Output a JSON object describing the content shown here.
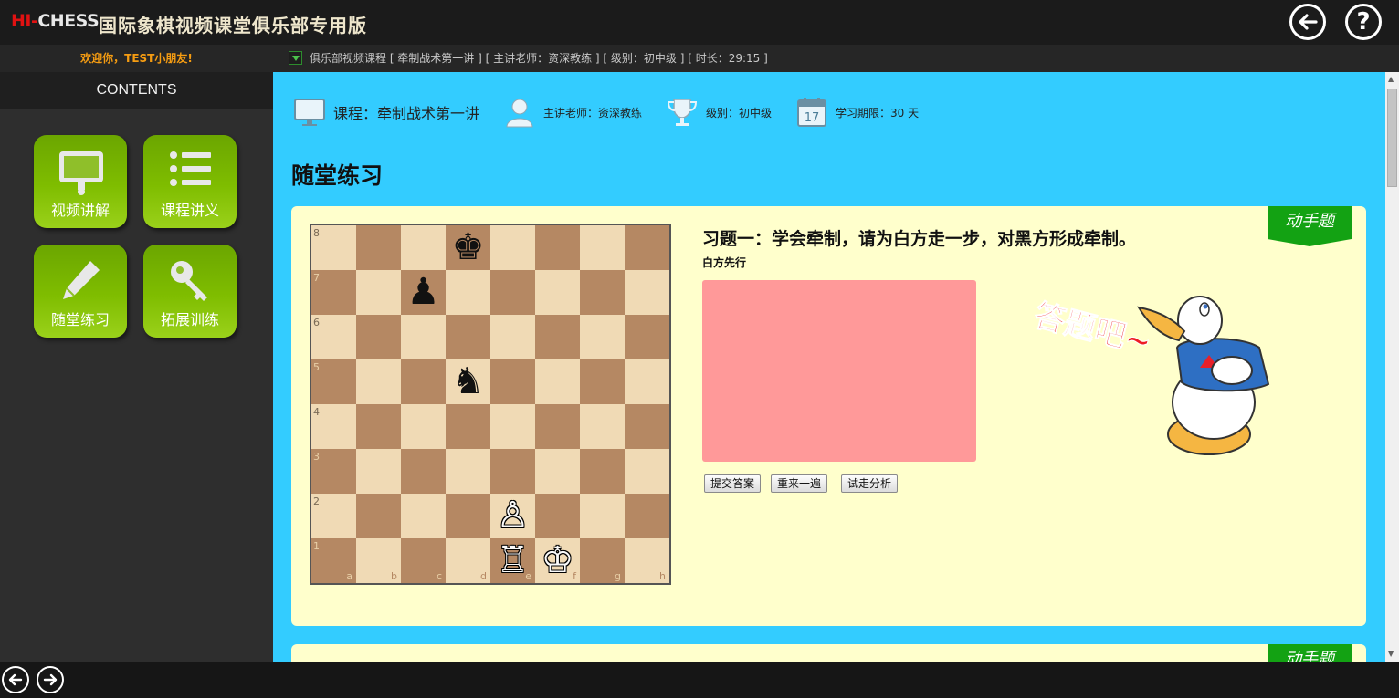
{
  "header": {
    "logo_hi": "HI-",
    "logo_chess": "CHESS",
    "app_title": "国际象棋视频课堂俱乐部专用版",
    "help_label": "?"
  },
  "sidebar": {
    "welcome": "欢迎你，TEST小朋友!",
    "contents_title": "CONTENTS",
    "tiles": [
      {
        "label": "视频讲解",
        "icon": "monitor-icon"
      },
      {
        "label": "课程讲义",
        "icon": "list-icon"
      },
      {
        "label": "随堂练习",
        "icon": "pencil-icon"
      },
      {
        "label": "拓展训练",
        "icon": "key-icon"
      }
    ]
  },
  "infobar": {
    "text": "俱乐部视频课程 [ 牵制战术第一讲 ] [ 主讲老师：资深教练 ] [ 级别：初中级 ] [ 时长：29:15 ]"
  },
  "meta": {
    "course": "课程：牵制战术第一讲",
    "teacher": "主讲老师：资深教练",
    "level": "级别：初中级",
    "period": "学习期限：30 天",
    "calendar_day": "17"
  },
  "section_title": "随堂练习",
  "exercise": {
    "ribbon": "动手题",
    "title": "习题一：学会牵制，请为白方走一步，对黑方形成牵制。",
    "subtitle": "白方先行",
    "buttons": [
      "提交答案",
      "重来一遍",
      "试走分析"
    ],
    "cheer_text": "答题吧~",
    "ranks": [
      "8",
      "7",
      "6",
      "5",
      "4",
      "3",
      "2",
      "1"
    ],
    "files": [
      "a",
      "b",
      "c",
      "d",
      "e",
      "f",
      "g",
      "h"
    ],
    "pieces": [
      {
        "square": "d8",
        "glyph": "♚",
        "color": "black"
      },
      {
        "square": "c7",
        "glyph": "♟",
        "color": "black"
      },
      {
        "square": "d5",
        "glyph": "♞",
        "color": "black"
      },
      {
        "square": "e2",
        "glyph": "♙",
        "color": "white"
      },
      {
        "square": "e1",
        "glyph": "♖",
        "color": "white"
      },
      {
        "square": "f1",
        "glyph": "♔",
        "color": "white"
      }
    ]
  },
  "second_card": {
    "ribbon": "动手题"
  },
  "colors": {
    "accent_green": "#13a213",
    "main_bg": "#33ccff",
    "card_bg": "#ffffcc",
    "answer_box": "#ff9999",
    "welcome_orange": "#f59c12"
  }
}
